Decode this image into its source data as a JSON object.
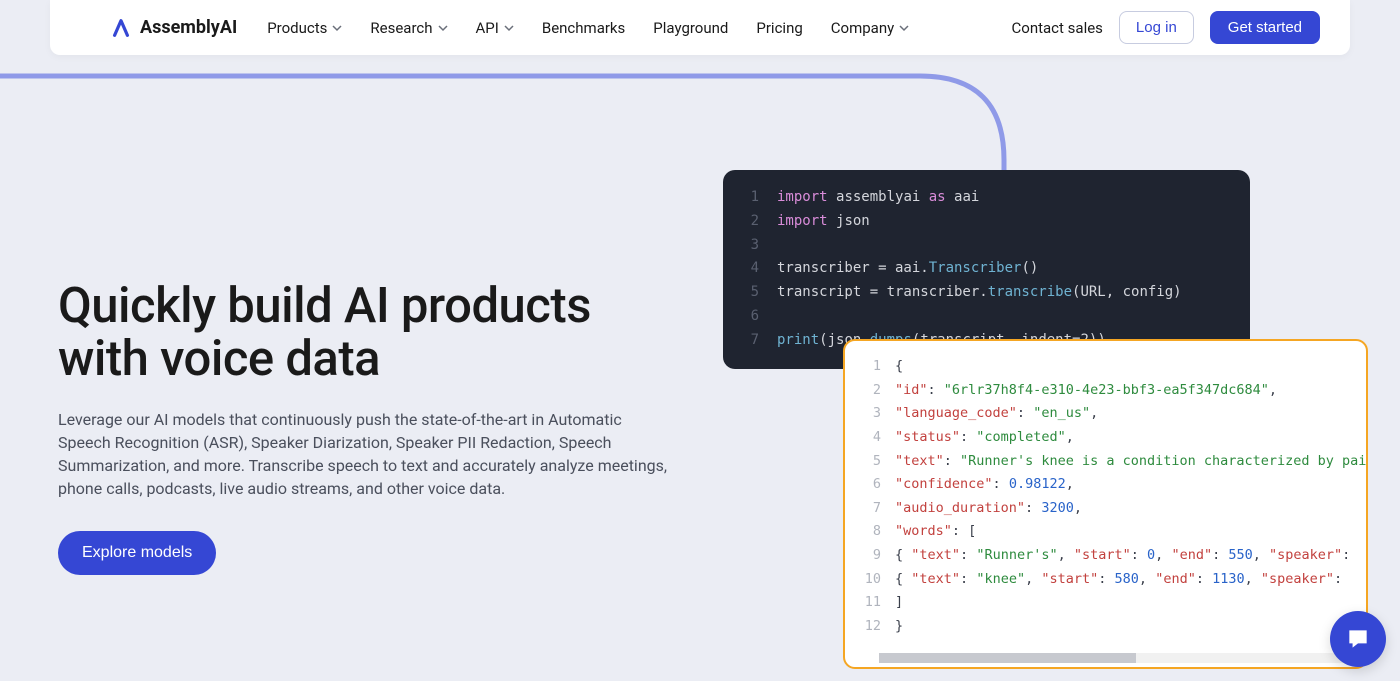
{
  "brand": "AssemblyAI",
  "nav": {
    "items": [
      {
        "label": "Products",
        "dropdown": true
      },
      {
        "label": "Research",
        "dropdown": true
      },
      {
        "label": "API",
        "dropdown": true
      },
      {
        "label": "Benchmarks",
        "dropdown": false
      },
      {
        "label": "Playground",
        "dropdown": false
      },
      {
        "label": "Pricing",
        "dropdown": false
      },
      {
        "label": "Company",
        "dropdown": true
      }
    ],
    "contact": "Contact sales",
    "login": "Log in",
    "getstarted": "Get started"
  },
  "hero": {
    "title": "Quickly build AI products with voice data",
    "subtitle": "Leverage our AI models that continuously push the state-of-the-art in Automatic Speech Recognition (ASR), Speaker Diarization, Speaker PII Redaction, Speech Summarization, and more. Transcribe speech to text and accurately analyze meetings, phone calls, podcasts, live audio streams, and other voice data.",
    "cta": "Explore models"
  },
  "code_dark": {
    "lines": [
      [
        {
          "t": "kw",
          "v": "import"
        },
        {
          "t": "plain",
          "v": " "
        },
        {
          "t": "id",
          "v": "assemblyai"
        },
        {
          "t": "plain",
          "v": " "
        },
        {
          "t": "as",
          "v": "as"
        },
        {
          "t": "plain",
          "v": " "
        },
        {
          "t": "name",
          "v": "aai"
        }
      ],
      [
        {
          "t": "kw",
          "v": "import"
        },
        {
          "t": "plain",
          "v": " "
        },
        {
          "t": "id",
          "v": "json"
        }
      ],
      [],
      [
        {
          "t": "plain",
          "v": "transcriber = aai."
        },
        {
          "t": "fn",
          "v": "Transcriber"
        },
        {
          "t": "plain",
          "v": "()"
        }
      ],
      [
        {
          "t": "plain",
          "v": "transcript = transcriber."
        },
        {
          "t": "fn",
          "v": "transcribe"
        },
        {
          "t": "plain",
          "v": "(URL, config)"
        }
      ],
      [],
      [
        {
          "t": "fn",
          "v": "print"
        },
        {
          "t": "plain",
          "v": "(json."
        },
        {
          "t": "fn",
          "v": "dumps"
        },
        {
          "t": "plain",
          "v": "(transcript, indent="
        },
        {
          "t": "plain",
          "v": "2"
        },
        {
          "t": "plain",
          "v": "))"
        }
      ]
    ]
  },
  "code_light": {
    "lines": [
      [
        {
          "t": "plain",
          "v": "{"
        }
      ],
      [
        {
          "t": "plain",
          "v": "  "
        },
        {
          "t": "key",
          "v": "\"id\""
        },
        {
          "t": "plain",
          "v": ": "
        },
        {
          "t": "str",
          "v": "\"6rlr37h8f4-e310-4e23-bbf3-ea5f347dc684\""
        },
        {
          "t": "plain",
          "v": ","
        }
      ],
      [
        {
          "t": "plain",
          "v": "  "
        },
        {
          "t": "key",
          "v": "\"language_code\""
        },
        {
          "t": "plain",
          "v": ": "
        },
        {
          "t": "str",
          "v": "\"en_us\""
        },
        {
          "t": "plain",
          "v": ","
        }
      ],
      [
        {
          "t": "plain",
          "v": "  "
        },
        {
          "t": "key",
          "v": "\"status\""
        },
        {
          "t": "plain",
          "v": ": "
        },
        {
          "t": "str",
          "v": "\"completed\""
        },
        {
          "t": "plain",
          "v": ","
        }
      ],
      [
        {
          "t": "plain",
          "v": "  "
        },
        {
          "t": "key",
          "v": "\"text\""
        },
        {
          "t": "plain",
          "v": ": "
        },
        {
          "t": "str",
          "v": "\"Runner's knee is a condition characterized by pain"
        }
      ],
      [
        {
          "t": "plain",
          "v": "  "
        },
        {
          "t": "key",
          "v": "\"confidence\""
        },
        {
          "t": "plain",
          "v": ": "
        },
        {
          "t": "num",
          "v": "0.98122"
        },
        {
          "t": "plain",
          "v": ","
        }
      ],
      [
        {
          "t": "plain",
          "v": "  "
        },
        {
          "t": "key",
          "v": "\"audio_duration\""
        },
        {
          "t": "plain",
          "v": ": "
        },
        {
          "t": "num",
          "v": "3200"
        },
        {
          "t": "plain",
          "v": ","
        }
      ],
      [
        {
          "t": "plain",
          "v": "  "
        },
        {
          "t": "key",
          "v": "\"words\""
        },
        {
          "t": "plain",
          "v": ": ["
        }
      ],
      [
        {
          "t": "plain",
          "v": "    { "
        },
        {
          "t": "key",
          "v": "\"text\""
        },
        {
          "t": "plain",
          "v": ": "
        },
        {
          "t": "str",
          "v": "\"Runner's\""
        },
        {
          "t": "plain",
          "v": ", "
        },
        {
          "t": "key",
          "v": "\"start\""
        },
        {
          "t": "plain",
          "v": ": "
        },
        {
          "t": "num",
          "v": "0"
        },
        {
          "t": "plain",
          "v": ", "
        },
        {
          "t": "key",
          "v": "\"end\""
        },
        {
          "t": "plain",
          "v": ": "
        },
        {
          "t": "num",
          "v": "550"
        },
        {
          "t": "plain",
          "v": ", "
        },
        {
          "t": "key",
          "v": "\"speaker\""
        },
        {
          "t": "plain",
          "v": ":"
        }
      ],
      [
        {
          "t": "plain",
          "v": "    { "
        },
        {
          "t": "key",
          "v": "\"text\""
        },
        {
          "t": "plain",
          "v": ": "
        },
        {
          "t": "str",
          "v": "\"knee\""
        },
        {
          "t": "plain",
          "v": ", "
        },
        {
          "t": "key",
          "v": "\"start\""
        },
        {
          "t": "plain",
          "v": ": "
        },
        {
          "t": "num",
          "v": "580"
        },
        {
          "t": "plain",
          "v": ", "
        },
        {
          "t": "key",
          "v": "\"end\""
        },
        {
          "t": "plain",
          "v": ": "
        },
        {
          "t": "num",
          "v": "1130"
        },
        {
          "t": "plain",
          "v": ", "
        },
        {
          "t": "key",
          "v": "\"speaker\""
        },
        {
          "t": "plain",
          "v": ": "
        }
      ],
      [
        {
          "t": "plain",
          "v": "  ]"
        }
      ],
      [
        {
          "t": "plain",
          "v": "}"
        }
      ]
    ]
  }
}
